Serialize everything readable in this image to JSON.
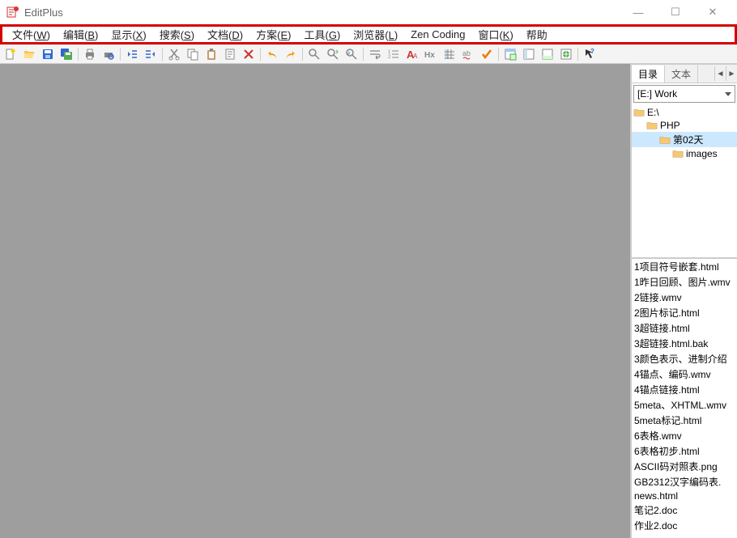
{
  "app": {
    "title": "EditPlus"
  },
  "window_controls": {
    "min": "—",
    "max": "☐",
    "close": "✕"
  },
  "menu": [
    {
      "label": "文件",
      "key": "W"
    },
    {
      "label": "编辑",
      "key": "B"
    },
    {
      "label": "显示",
      "key": "X"
    },
    {
      "label": "搜索",
      "key": "S"
    },
    {
      "label": "文档",
      "key": "D"
    },
    {
      "label": "方案",
      "key": "E"
    },
    {
      "label": "工具",
      "key": "G"
    },
    {
      "label": "浏览器",
      "key": "L"
    },
    {
      "label": "Zen Coding",
      "key": ""
    },
    {
      "label": "窗口",
      "key": "K"
    },
    {
      "label": "帮助",
      "key": ""
    }
  ],
  "toolbar_icons": [
    "new-file",
    "open-file",
    "save",
    "save-all",
    "sep",
    "print",
    "print-preview",
    "sep",
    "indent-left",
    "indent-right",
    "sep",
    "cut",
    "copy",
    "paste",
    "clipboard",
    "delete",
    "sep",
    "undo",
    "redo",
    "sep",
    "find",
    "find-replace",
    "goto",
    "sep",
    "word-wrap",
    "line-numbers",
    "font-large",
    "hex-view",
    "column-select",
    "spell-check",
    "check-mark",
    "sep",
    "browser-mode",
    "toggle-dir",
    "show-output",
    "browser-preview",
    "sep",
    "help-arrow"
  ],
  "sidebar": {
    "tabs": {
      "active": "目录",
      "inactive": "文本"
    },
    "drive": "[E:] Work",
    "tree": [
      {
        "label": "E:\\",
        "indent": 0,
        "selected": false
      },
      {
        "label": "PHP",
        "indent": 1,
        "selected": false
      },
      {
        "label": "第02天",
        "indent": 2,
        "selected": true
      },
      {
        "label": "images",
        "indent": 3,
        "selected": false
      }
    ],
    "files": [
      "1项目符号嵌套.html",
      "1昨日回顾、图片.wmv",
      "2链接.wmv",
      "2图片标记.html",
      "3超链接.html",
      "3超链接.html.bak",
      "3颜色表示、进制介绍",
      "4锚点、编码.wmv",
      "4锚点链接.html",
      "5meta、XHTML.wmv",
      "5meta标记.html",
      "6表格.wmv",
      "6表格初步.html",
      "ASCII码对照表.png",
      "GB2312汉字编码表.",
      "news.html",
      "笔记2.doc",
      "作业2.doc"
    ]
  }
}
